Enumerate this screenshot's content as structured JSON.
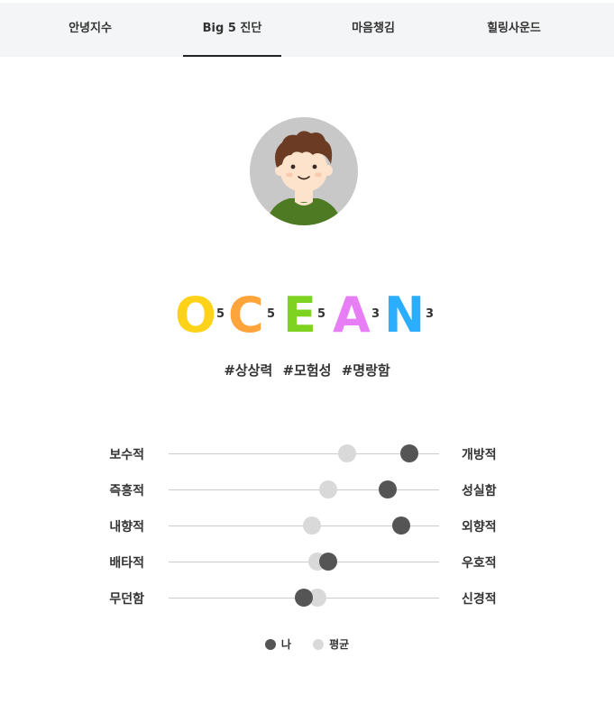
{
  "tabs": [
    {
      "label": "안녕지수",
      "active": false
    },
    {
      "label": "Big 5 진단",
      "active": true
    },
    {
      "label": "마음챙김",
      "active": false
    },
    {
      "label": "힐링사운드",
      "active": false
    }
  ],
  "ocean": [
    {
      "letter": "O",
      "score": "5",
      "color": "#FFD21A"
    },
    {
      "letter": "C",
      "score": "5",
      "color": "#FFA43A"
    },
    {
      "letter": "E",
      "score": "5",
      "color": "#7ED321"
    },
    {
      "letter": "A",
      "score": "3",
      "color": "#E87EF5"
    },
    {
      "letter": "N",
      "score": "3",
      "color": "#2BAEFF"
    }
  ],
  "hashtags": [
    "#상상력",
    "#모험성",
    "#명랑함"
  ],
  "traits": [
    {
      "left": "보수적",
      "right": "개방적",
      "avg": 0.66,
      "me": 0.89
    },
    {
      "left": "즉흥적",
      "right": "성실함",
      "avg": 0.59,
      "me": 0.81
    },
    {
      "left": "내향적",
      "right": "외향적",
      "avg": 0.53,
      "me": 0.86
    },
    {
      "left": "배타적",
      "right": "우호적",
      "avg": 0.55,
      "me": 0.59
    },
    {
      "left": "무던함",
      "right": "신경적",
      "avg": 0.55,
      "me": 0.5
    }
  ],
  "legend": {
    "me": "나",
    "avg": "평균"
  },
  "colors": {
    "me": "#555555",
    "avg": "#d9d9d9"
  }
}
